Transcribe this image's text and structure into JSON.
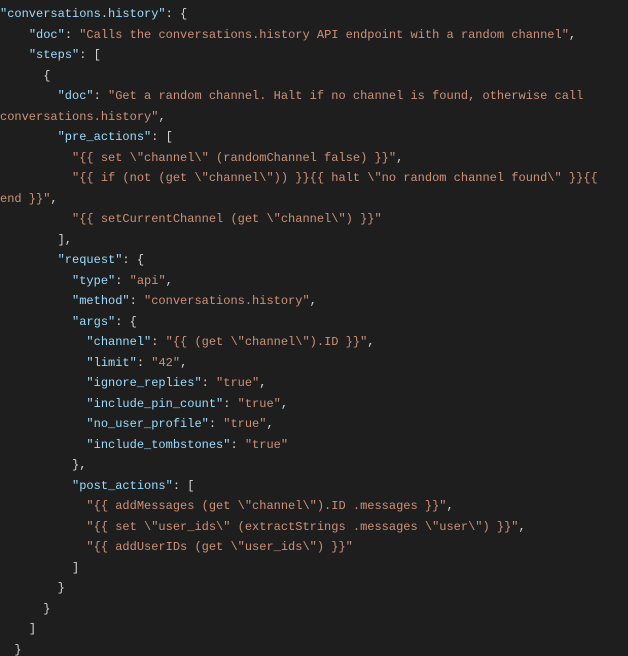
{
  "code": {
    "top_key": "\"conversations.history\"",
    "doc_key": "\"doc\"",
    "doc_val": "\"Calls the conversations.history API endpoint with a random channel\"",
    "steps_key": "\"steps\"",
    "step_doc_key": "\"doc\"",
    "step_doc_val_a": "\"Get a random channel. Halt if no channel is found, otherwise call",
    "step_doc_val_b": "conversations.history\"",
    "pre_actions_key": "\"pre_actions\"",
    "pre0": "\"{{ set \\\"channel\\\" (randomChannel false) }}\"",
    "pre1a": "\"{{ if (not (get \\\"channel\\\")) }}{{ halt \\\"no random channel found\\\" }}{{",
    "pre1b": "end }}\"",
    "pre2": "\"{{ setCurrentChannel (get \\\"channel\\\") }}\"",
    "request_key": "\"request\"",
    "type_key": "\"type\"",
    "type_val": "\"api\"",
    "method_key": "\"method\"",
    "method_val": "\"conversations.history\"",
    "args_key": "\"args\"",
    "arg_channel_key": "\"channel\"",
    "arg_channel_val": "\"{{ (get \\\"channel\\\").ID }}\"",
    "arg_limit_key": "\"limit\"",
    "arg_limit_val": "\"42\"",
    "arg_ignore_replies_key": "\"ignore_replies\"",
    "arg_ignore_replies_val": "\"true\"",
    "arg_include_pin_count_key": "\"include_pin_count\"",
    "arg_include_pin_count_val": "\"true\"",
    "arg_no_user_profile_key": "\"no_user_profile\"",
    "arg_no_user_profile_val": "\"true\"",
    "arg_include_tombstones_key": "\"include_tombstones\"",
    "arg_include_tombstones_val": "\"true\"",
    "post_actions_key": "\"post_actions\"",
    "post0": "\"{{ addMessages (get \\\"channel\\\").ID .messages }}\"",
    "post1": "\"{{ set \\\"user_ids\\\" (extractStrings .messages \\\"user\\\") }}\"",
    "post2": "\"{{ addUserIDs (get \\\"user_ids\\\") }}\""
  }
}
